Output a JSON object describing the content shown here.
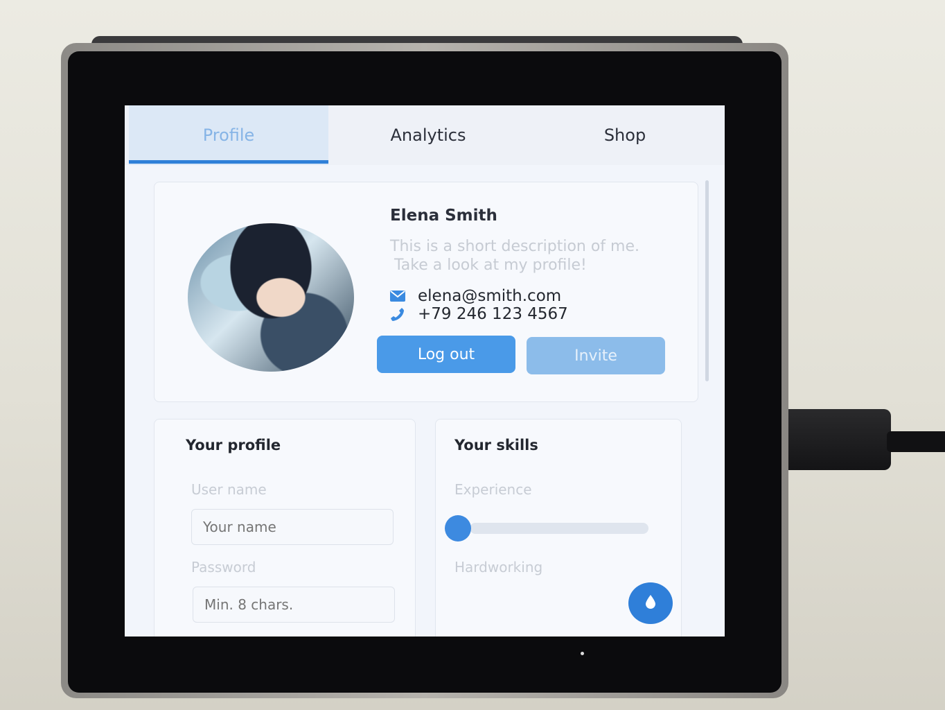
{
  "tabs": [
    {
      "label": "Profile",
      "active": true
    },
    {
      "label": "Analytics",
      "active": false
    },
    {
      "label": "Shop",
      "active": false
    }
  ],
  "profile": {
    "name": "Elena Smith",
    "description_line1": "This is a short description of me.",
    "description_line2": "Take a look at my profile!",
    "email": "elena@smith.com",
    "phone": "+79 246 123 4567",
    "email_icon": "envelope-icon",
    "phone_icon": "phone-icon",
    "logout_label": "Log out",
    "invite_label": "Invite"
  },
  "your_profile": {
    "title": "Your profile",
    "username_label": "User name",
    "username_placeholder": "Your name",
    "password_label": "Password",
    "password_placeholder": "Min. 8 chars."
  },
  "your_skills": {
    "title": "Your skills",
    "experience_label": "Experience",
    "experience_value": 0.0,
    "hardworking_label": "Hardworking"
  },
  "fab": {
    "icon": "drop-icon"
  },
  "colors": {
    "accent": "#2f80d8",
    "button_primary": "#4a9ae8",
    "button_secondary": "#8cbcea",
    "screen_bg": "#f2f5fb"
  }
}
